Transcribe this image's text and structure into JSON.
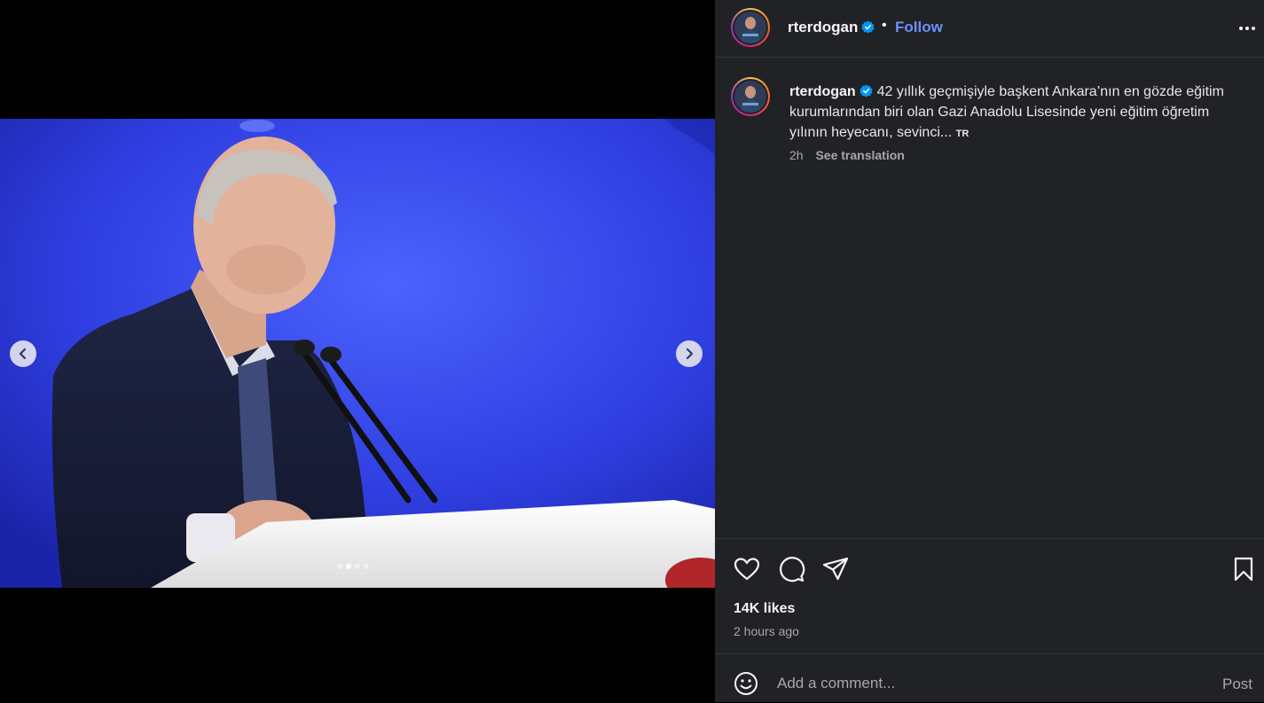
{
  "post": {
    "username": "rterdogan",
    "separator": "•",
    "follow_label": "Follow",
    "caption": "42 yıllık geçmişiyle başkent Ankara’nın en gözde eğitim kurumlarından biri olan Gazi Anadolu Lisesinde yeni eğitim öğretim yılının heyecanı, sevinci...",
    "caption_lang": "TR",
    "caption_time": "2h",
    "see_translation": "See translation",
    "likes": "14K likes",
    "age": "2 hours ago"
  },
  "carousel": {
    "total_slides": 4,
    "active_index": 1
  },
  "comment": {
    "placeholder": "Add a comment...",
    "post_label": "Post"
  },
  "icons": {
    "prev": "chevron-left-icon",
    "next": "chevron-right-icon",
    "like": "heart-icon",
    "comment": "comment-bubble-icon",
    "share": "paper-plane-icon",
    "save": "bookmark-icon",
    "emoji": "smiley-icon",
    "verified": "verified-badge-icon",
    "more": "more-options-icon"
  },
  "colors": {
    "panel_bg": "#212226",
    "link_blue": "#6d8eff",
    "verified_blue": "#0095f6"
  }
}
